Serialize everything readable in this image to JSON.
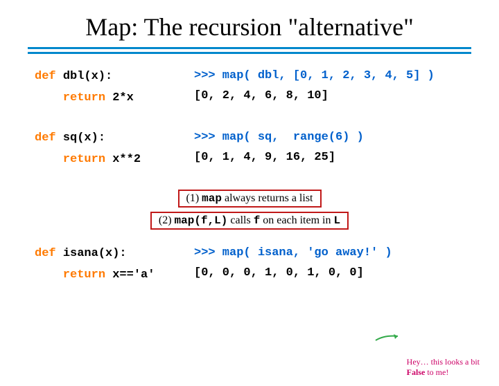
{
  "title": "Map: The recursion \"alternative\"",
  "code": {
    "dbl": {
      "def": "def ",
      "sig": "dbl(x):",
      "ret": "    return ",
      "body": "2*x",
      "call": ">>> map( dbl, [0, 1, 2, 3, 4, 5] )",
      "out": "[0, 2, 4, 6, 8, 10]"
    },
    "sq": {
      "def": "def ",
      "sig": "sq(x):",
      "ret": "    return ",
      "body": "x**2",
      "call": ">>> map( sq,  range(6) )",
      "out": "[0, 1, 4, 9, 16, 25]"
    },
    "isana": {
      "def": "def ",
      "sig": "isana(x):",
      "ret": "    return ",
      "body": "x=='a'",
      "call": ">>> map( isana, 'go away!' )",
      "out": "[0, 0, 0, 1, 0, 1, 0, 0]"
    }
  },
  "notes": {
    "n1_a": "(1) ",
    "n1_b": "map",
    "n1_c": " always returns a list",
    "n2_a": "(2) ",
    "n2_b": "map(f,L)",
    "n2_c": " calls ",
    "n2_d": "f",
    "n2_e": " on each item in ",
    "n2_f": "L"
  },
  "annot": {
    "l1": "Hey… this looks a bit",
    "l2_a": "False",
    "l2_b": " to me!"
  }
}
